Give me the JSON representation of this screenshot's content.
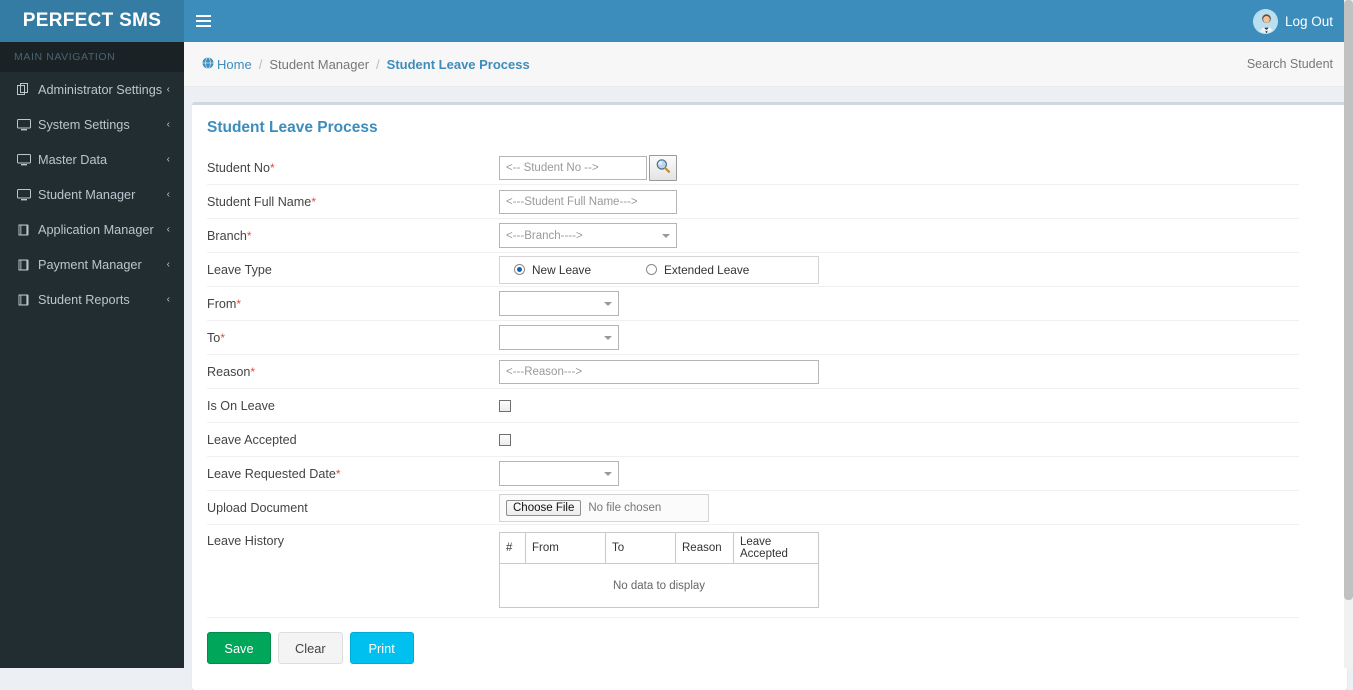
{
  "brand": {
    "name": "PERFECT SMS"
  },
  "topbar": {
    "menu_toggle_icon": "hamburger-icon",
    "user_icon": "avatar-icon",
    "logout_label": "Log Out"
  },
  "sidebar": {
    "section_header": "MAIN NAVIGATION",
    "items": [
      {
        "label": "Administrator Settings",
        "icon": "copy-icon",
        "caret": "‹"
      },
      {
        "label": "System Settings",
        "icon": "desktop-icon",
        "caret": "‹"
      },
      {
        "label": "Master Data",
        "icon": "desktop-icon",
        "caret": "‹"
      },
      {
        "label": "Student Manager",
        "icon": "desktop-icon",
        "caret": "‹"
      },
      {
        "label": "Application Manager",
        "icon": "book-icon",
        "caret": "‹"
      },
      {
        "label": "Payment Manager",
        "icon": "book-icon",
        "caret": "‹"
      },
      {
        "label": "Student Reports",
        "icon": "book-icon",
        "caret": "‹"
      }
    ]
  },
  "breadcrumb": {
    "home_icon": "home-globe-icon",
    "home": "Home",
    "sep": "/",
    "parent": "Student Manager",
    "current": "Student Leave Process",
    "search_student": "Search Student"
  },
  "page": {
    "title": "Student Leave Process"
  },
  "form": {
    "student_no": {
      "label": "Student No",
      "required": "*",
      "placeholder": "<-- Student No -->",
      "value": "",
      "search_icon": "magnifier-icon"
    },
    "student_full_name": {
      "label": "Student Full Name",
      "required": "*",
      "placeholder": "<---Student Full Name--->",
      "value": ""
    },
    "branch": {
      "label": "Branch",
      "required": "*",
      "placeholder": "<---Branch---->",
      "value": ""
    },
    "leave_type": {
      "label": "Leave Type",
      "required": "",
      "options": [
        {
          "label": "New Leave",
          "selected": true
        },
        {
          "label": "Extended Leave",
          "selected": false
        }
      ]
    },
    "from": {
      "label": "From",
      "required": "*",
      "value": ""
    },
    "to": {
      "label": "To",
      "required": "*",
      "value": ""
    },
    "reason": {
      "label": "Reason",
      "required": "*",
      "placeholder": "<---Reason--->",
      "value": ""
    },
    "is_on_leave": {
      "label": "Is On Leave",
      "checked": false
    },
    "leave_accepted": {
      "label": "Leave Accepted",
      "checked": false
    },
    "leave_requested_date": {
      "label": "Leave Requested Date",
      "required": "*",
      "value": ""
    },
    "upload_document": {
      "label": "Upload Document",
      "choose_label": "Choose File",
      "status": "No file chosen"
    },
    "leave_history": {
      "label": "Leave History",
      "columns": [
        "#",
        "From",
        "To",
        "Reason",
        "Leave Accepted"
      ],
      "rows": [],
      "empty_message": "No data to display"
    }
  },
  "actions": {
    "save": "Save",
    "clear": "Clear",
    "print": "Print"
  },
  "colors": {
    "header_blue": "#3c8dbc",
    "logo_blue": "#357ca5",
    "sidebar_dark": "#222d32",
    "accent_link": "#3c8dbc",
    "required_red": "#e74c3c",
    "save_green": "#00a65a",
    "print_cyan": "#00c0ef",
    "body_bg": "#ecf0f5"
  }
}
